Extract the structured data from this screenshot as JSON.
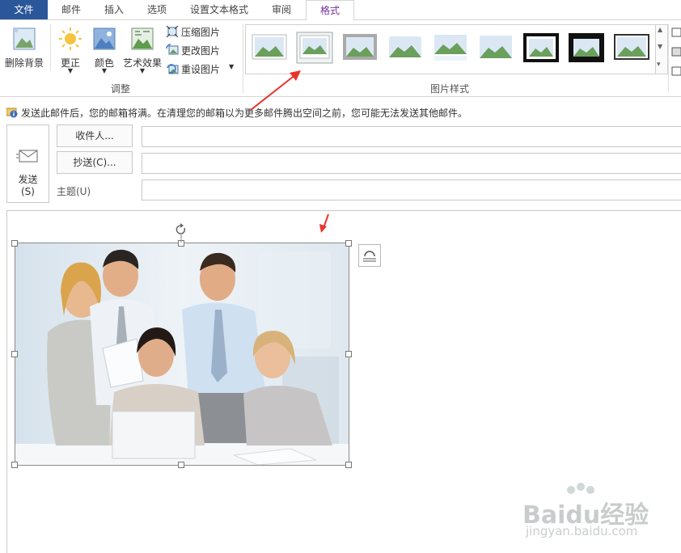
{
  "tabs": {
    "file": "文件",
    "mail": "邮件",
    "insert": "插入",
    "options": "选项",
    "format_text": "设置文本格式",
    "review": "审阅",
    "format": "格式"
  },
  "ribbon": {
    "remove_background": "删除背景",
    "corrections": "更正",
    "color": "颜色",
    "artistic_effects": "艺术效果",
    "compress_pictures": "压缩图片",
    "change_picture": "更改图片",
    "reset_picture": "重设图片",
    "adjust_group": "调整",
    "picture_styles_group": "图片样式"
  },
  "info_bar": {
    "message": "发送此邮件后，您的邮箱将满。在清理您的邮箱以为更多邮件腾出空间之前，您可能无法发送其他邮件。"
  },
  "compose": {
    "send_label": "发送",
    "send_shortcut": "(S)",
    "to_button": "收件人...",
    "cc_button": "抄送(C)...",
    "subject_label": "主题(U)",
    "to_value": "",
    "cc_value": "",
    "subject_value": ""
  },
  "watermark": {
    "brand": "Baidu经验",
    "url": "jingyan.baidu.com"
  },
  "colors": {
    "file_tab": "#2b579a",
    "format_tab_text": "#7030a0",
    "arrow": "#e8342a"
  }
}
